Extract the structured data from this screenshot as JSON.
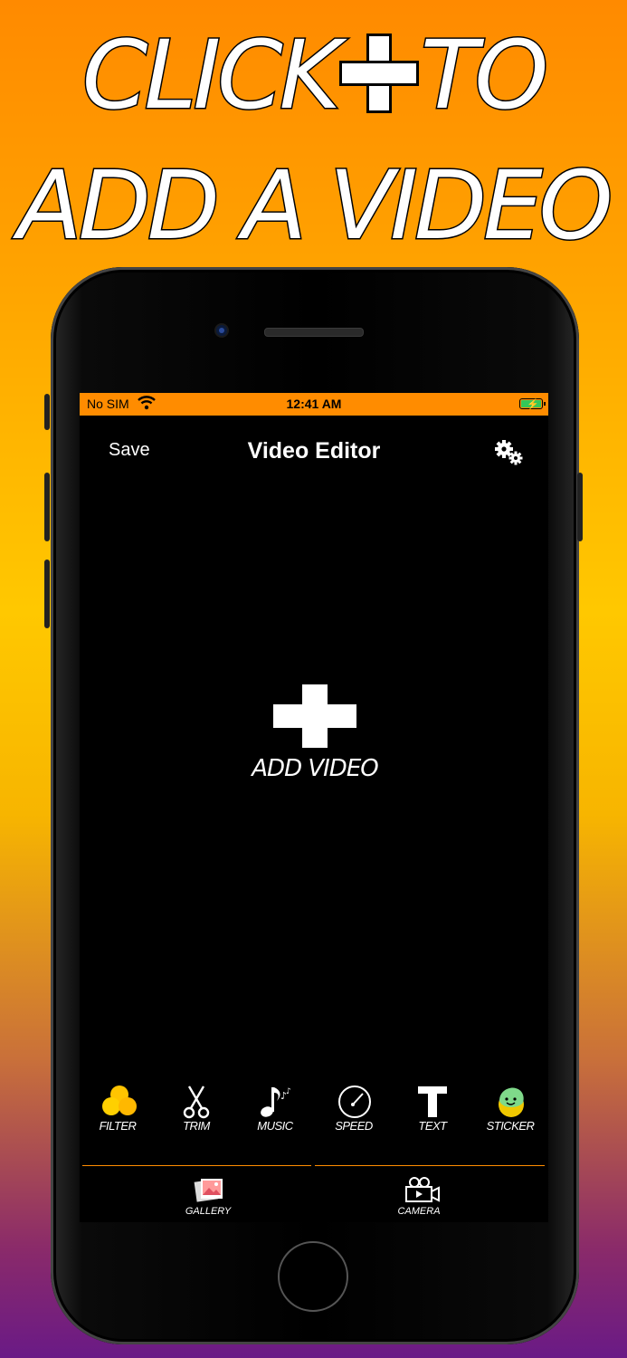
{
  "headline": {
    "line1_left": "CLICK",
    "line1_right": "TO",
    "line2": "ADD A VIDEO"
  },
  "status_bar": {
    "carrier": "No SIM",
    "time": "12:41 AM"
  },
  "nav": {
    "save_label": "Save",
    "title": "Video Editor"
  },
  "main": {
    "add_label": "ADD VIDEO"
  },
  "tools": [
    {
      "label": "FILTER",
      "icon": "filter-icon"
    },
    {
      "label": "TRIM",
      "icon": "scissors-icon"
    },
    {
      "label": "MUSIC",
      "icon": "music-note-icon"
    },
    {
      "label": "SPEED",
      "icon": "speedometer-icon"
    },
    {
      "label": "TEXT",
      "icon": "text-icon"
    },
    {
      "label": "STICKER",
      "icon": "sticker-icon"
    }
  ],
  "bottom_tabs": [
    {
      "label": "GALLERY",
      "icon": "gallery-icon"
    },
    {
      "label": "CAMERA",
      "icon": "camera-icon"
    }
  ],
  "colors": {
    "accent": "#ff8c00",
    "filter": "#ffc400",
    "sticker": "#7fd98a"
  }
}
